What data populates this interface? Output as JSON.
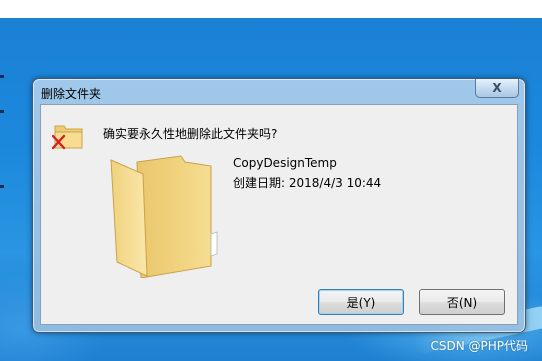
{
  "dialog": {
    "title": "删除文件夹",
    "close_glyph": "X",
    "close_icon": "close-icon",
    "question": "确实要永久性地删除此文件夹吗?",
    "folder_icon": "folder-icon",
    "file_name": "CopyDesignTemp",
    "file_created": "创建日期: 2018/4/3 10:44",
    "yes_label": "是(Y)",
    "no_label": "否(N)"
  },
  "watermark": "CSDN @PHP代码",
  "colors": {
    "desktop": "#1c88dc",
    "folder": "#f3d27c",
    "delete_x": "#d42020"
  }
}
